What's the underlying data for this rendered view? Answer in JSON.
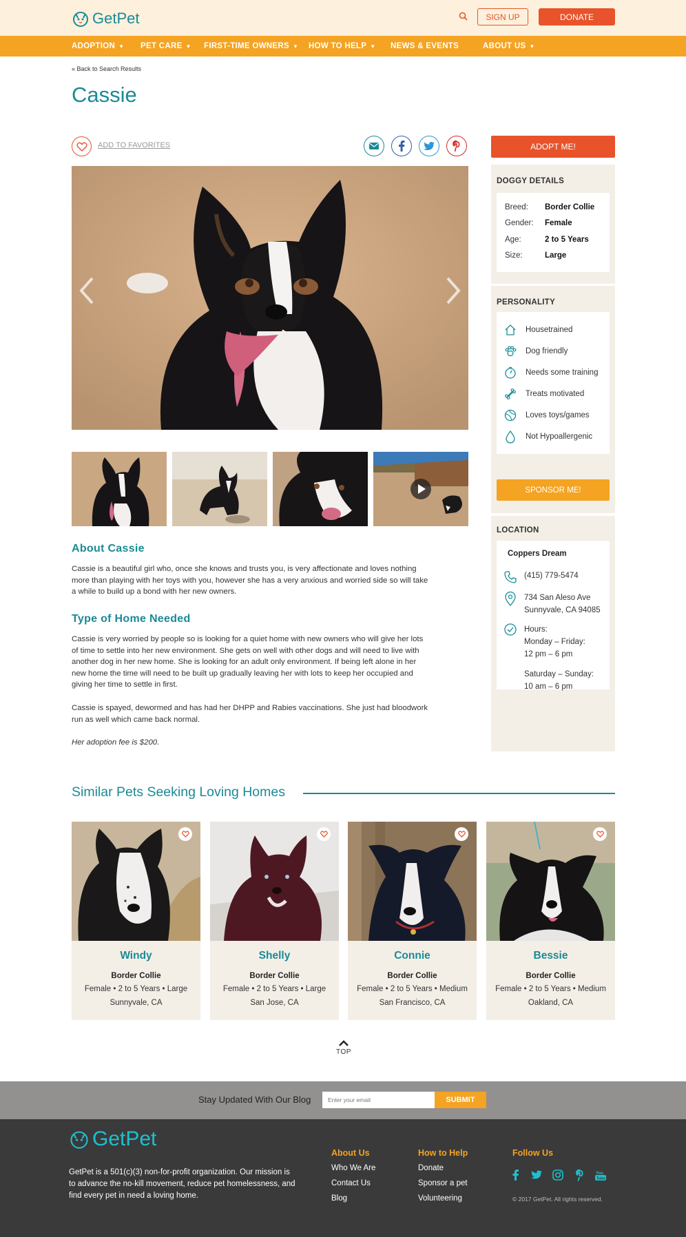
{
  "header": {
    "logo_text": "GetPet",
    "signup_label": "SIGN UP",
    "donate_label": "DONATE"
  },
  "nav": {
    "items": [
      {
        "label": "ADOPTION",
        "has_dropdown": true
      },
      {
        "label": "PET CARE",
        "has_dropdown": true
      },
      {
        "label": "FIRST-TIME OWNERS",
        "has_dropdown": true
      },
      {
        "label": "HOW TO HELP",
        "has_dropdown": true
      },
      {
        "label": "NEWS & EVENTS",
        "has_dropdown": false
      },
      {
        "label": "ABOUT US",
        "has_dropdown": true
      }
    ]
  },
  "back_link": "« Back to Search Results",
  "pet": {
    "name": "Cassie",
    "favorites_label": "ADD TO FAVORITES",
    "about_heading": "About Cassie",
    "about_text": "Cassie is a beautiful girl who, once she knows and trusts you, is very affectionate and loves nothing more than playing with her toys with you, however she has a very anxious and worried side so will take a while to build up a bond with her new owners.",
    "home_heading": "Type of Home Needed",
    "home_text_1": "Cassie is very worried by people so is looking for a quiet home with new owners who will give her lots of time to settle into her new environment. She gets on well with other dogs and will need to live with another dog in her new home. She is looking for an adult only environment. If being left alone in her new home the time will need to be built up gradually leaving her with lots to keep her occupied and giving her time to settle in first.",
    "home_text_2": "Cassie is spayed, dewormed and has had her DHPP and Rabies vaccinations. She just had bloodwork run as well which came back normal.",
    "fee_text": "Her adoption fee is $200."
  },
  "sidebar": {
    "adopt_label": "ADOPT ME!",
    "details_heading": "DOGGY DETAILS",
    "details": [
      {
        "key": "Breed:",
        "value": "Border Collie"
      },
      {
        "key": "Gender:",
        "value": "Female"
      },
      {
        "key": "Age:",
        "value": "2 to 5 Years"
      },
      {
        "key": "Size:",
        "value": "Large"
      }
    ],
    "personality_heading": "PERSONALITY",
    "personality": [
      {
        "icon": "house-icon",
        "label": "Housetrained"
      },
      {
        "icon": "paw-icon",
        "label": "Dog friendly"
      },
      {
        "icon": "stopwatch-icon",
        "label": "Needs some training"
      },
      {
        "icon": "bone-icon",
        "label": "Treats motivated"
      },
      {
        "icon": "ball-icon",
        "label": "Loves toys/games"
      },
      {
        "icon": "droplet-icon",
        "label": "Not Hypoallergenic"
      }
    ],
    "sponsor_label": "SPONSOR ME!",
    "location_heading": "LOCATION",
    "location_name": "Coppers Dream",
    "phone": "(415) 779-5474",
    "address_1": "734 San Aleso Ave",
    "address_2": "Sunnyvale, CA 94085",
    "hours_label": "Hours:",
    "hours_weekday_label": "Monday – Friday:",
    "hours_weekday": "12 pm – 6 pm",
    "hours_weekend_label": "Saturday – Sunday:",
    "hours_weekend": "10 am – 6 pm"
  },
  "similar": {
    "heading": "Similar Pets Seeking Loving Homes",
    "pets": [
      {
        "name": "Windy",
        "breed": "Border Collie",
        "info": "Female • 2 to 5 Years • Large",
        "location": "Sunnyvale, CA"
      },
      {
        "name": "Shelly",
        "breed": "Border Collie",
        "info": "Female • 2 to 5 Years • Large",
        "location": "San Jose, CA"
      },
      {
        "name": "Connie",
        "breed": "Border Collie",
        "info": "Female • 2 to 5 Years • Medium",
        "location": "San Francisco, CA"
      },
      {
        "name": "Bessie",
        "breed": "Border Collie",
        "info": "Female • 2 to 5 Years • Medium",
        "location": "Oakland, CA"
      }
    ]
  },
  "top_label": "TOP",
  "newsletter": {
    "label": "Stay Updated With Our Blog",
    "placeholder": "Enter your email",
    "submit_label": "SUBMIT"
  },
  "footer": {
    "logo_text": "GetPet",
    "description": "GetPet is a 501(c)(3) non-for-profit organization. Our mission is to advance the no-kill movement, reduce pet homelessness, and find every pet in need a loving home.",
    "about_heading": "About Us",
    "about_links": [
      "Who We Are",
      "Contact Us",
      "Blog"
    ],
    "help_heading": "How to Help",
    "help_links": [
      "Donate",
      "Sponsor a pet",
      "Volunteering"
    ],
    "follow_heading": "Follow Us",
    "copyright": "© 2017 GetPet.  All rights reserved."
  },
  "colors": {
    "teal": "#1a8a96",
    "orange": "#f4a322",
    "red_orange": "#e8532b",
    "cream": "#fdf0dc"
  }
}
